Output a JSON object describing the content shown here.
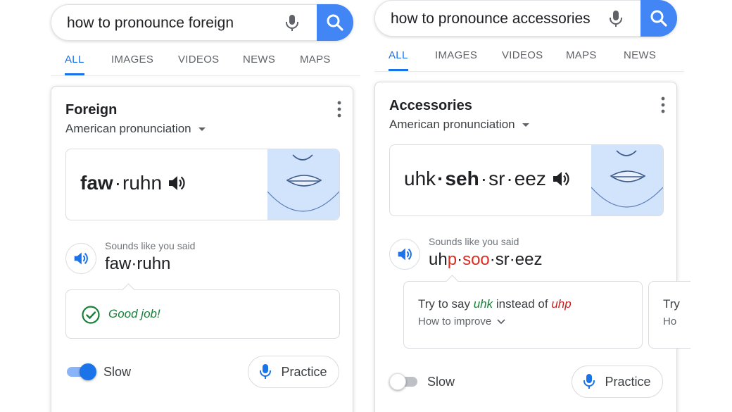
{
  "left": {
    "search": {
      "query": "how to pronounce foreign"
    },
    "tabs": [
      "ALL",
      "IMAGES",
      "VIDEOS",
      "NEWS",
      "MAPS"
    ],
    "active_tab": "ALL",
    "word": "Foreign",
    "accent": "American pronunciation",
    "phonetic": {
      "s1": "faw",
      "sep": "·",
      "s2": "ruhn"
    },
    "said_label": "Sounds like you said",
    "said": {
      "s1": "faw",
      "sep": "·",
      "s2": "ruhn"
    },
    "feedback": "Good job!",
    "slow_label": "Slow",
    "slow_on": true,
    "practice_label": "Practice"
  },
  "right": {
    "search": {
      "query": "how to pronounce accessories"
    },
    "tabs": [
      "ALL",
      "IMAGES",
      "VIDEOS",
      "MAPS",
      "NEWS"
    ],
    "active_tab": "ALL",
    "word": "Accessories",
    "accent": "American pronunciation",
    "phonetic": {
      "s1": "uhk",
      "s2": "seh",
      "s3": "sr",
      "s4": "eez",
      "sep": "·"
    },
    "said_label": "Sounds like you said",
    "said": {
      "a": "uh",
      "b": "p",
      "c": "·",
      "d": "soo",
      "e": "·sr·eez"
    },
    "tip": {
      "pre": "Try to say ",
      "good": "uhk",
      "mid": " instead of ",
      "bad": "uhp"
    },
    "improve": "How to improve",
    "tip2": {
      "line1": "Try",
      "line2": "Ho"
    },
    "slow_label": "Slow",
    "slow_on": false,
    "practice_label": "Practice"
  },
  "colors": {
    "accent": "#1a73e8",
    "search_button": "#4285f4",
    "good": "#188038",
    "bad": "#d93025",
    "mouth_bg": "#d2e3fc"
  }
}
